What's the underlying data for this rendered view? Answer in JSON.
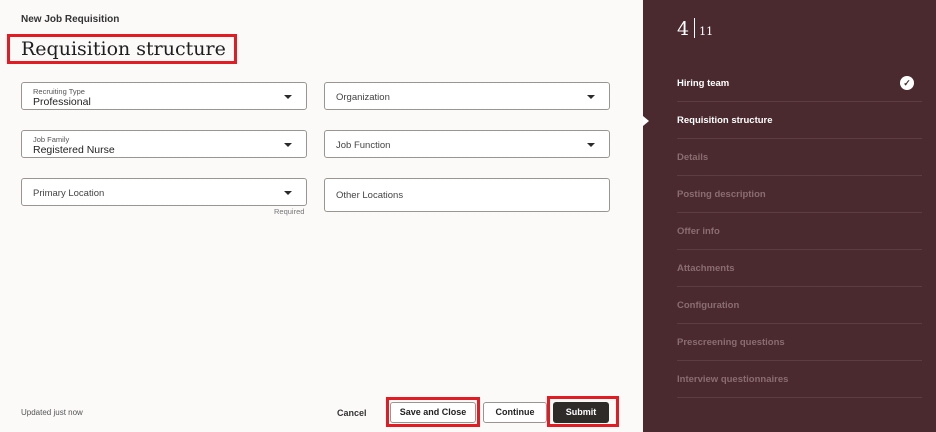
{
  "page": {
    "subtitle": "New Job Requisition",
    "title": "Requisition structure"
  },
  "fields": {
    "recruiting_type": {
      "label": "Recruiting Type",
      "value": "Professional"
    },
    "organization": {
      "label": "Organization"
    },
    "job_family": {
      "label": "Job Family",
      "value": "Registered Nurse"
    },
    "job_function": {
      "label": "Job Function"
    },
    "primary_location": {
      "label": "Primary Location",
      "hint": "Required"
    },
    "other_locations": {
      "label": "Other Locations"
    }
  },
  "footer": {
    "status": "Updated just now",
    "cancel_label": "Cancel",
    "save_close_label": "Save and Close",
    "continue_label": "Continue",
    "submit_label": "Submit"
  },
  "steps": {
    "current": "4",
    "total": "11",
    "items": [
      {
        "label": "Hiring team",
        "state": "done"
      },
      {
        "label": "Requisition structure",
        "state": "active"
      },
      {
        "label": "Details",
        "state": "todo"
      },
      {
        "label": "Posting description",
        "state": "todo"
      },
      {
        "label": "Offer info",
        "state": "todo"
      },
      {
        "label": "Attachments",
        "state": "todo"
      },
      {
        "label": "Configuration",
        "state": "todo"
      },
      {
        "label": "Prescreening questions",
        "state": "todo"
      },
      {
        "label": "Interview questionnaires",
        "state": "todo"
      }
    ]
  },
  "icons": {
    "dropdown": "chevron-down-icon",
    "completed": "checkmark-icon",
    "current_step": "triangle-pointer-icon"
  },
  "colors": {
    "sidebar_bg": "#4a2a2f",
    "highlight": "#e31b23",
    "submit_bg": "#2e2b28"
  }
}
